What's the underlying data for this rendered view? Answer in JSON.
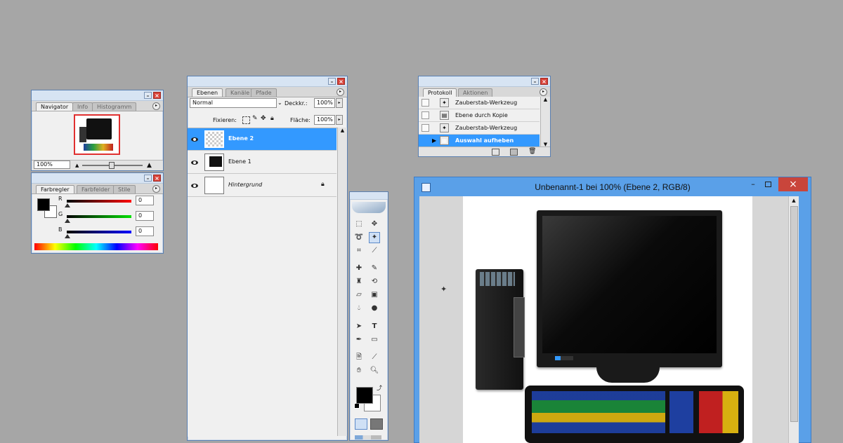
{
  "navigator": {
    "tabs": [
      "Navigator",
      "Info",
      "Histogramm"
    ],
    "zoom": "100%"
  },
  "color_panel": {
    "tabs": [
      "Farbregler",
      "Farbfelder",
      "Stile"
    ],
    "channels": [
      {
        "label": "R",
        "value": "0",
        "color": "#d01010"
      },
      {
        "label": "G",
        "value": "0",
        "color": "#10b010"
      },
      {
        "label": "B",
        "value": "0",
        "color": "#1010d0"
      }
    ]
  },
  "layers": {
    "tabs": [
      "Ebenen",
      "Kanäle",
      "Pfade"
    ],
    "blend_mode": "Normal",
    "opacity_label": "Deckkr.:",
    "opacity_value": "100%",
    "lock_label": "Fixieren:",
    "fill_label": "Fläche:",
    "fill_value": "100%",
    "items": [
      {
        "name": "Ebene 2",
        "selected": true
      },
      {
        "name": "Ebene 1",
        "selected": false
      },
      {
        "name": "Hintergrund",
        "selected": false
      }
    ]
  },
  "history": {
    "tabs": [
      "Protokoll",
      "Aktionen"
    ],
    "items": [
      {
        "label": "Zauberstab-Werkzeug",
        "selected": false
      },
      {
        "label": "Ebene durch Kopie",
        "selected": false
      },
      {
        "label": "Zauberstab-Werkzeug",
        "selected": false
      },
      {
        "label": "Auswahl aufheben",
        "selected": true
      }
    ]
  },
  "document": {
    "title": "Unbenannt-1 bei 100% (Ebene 2, RGB/8)"
  },
  "colors": {
    "accent": "#3399ff",
    "window_blue": "#5aa0e8",
    "close_red": "#d9433a",
    "workspace": "#a6a6a6"
  }
}
